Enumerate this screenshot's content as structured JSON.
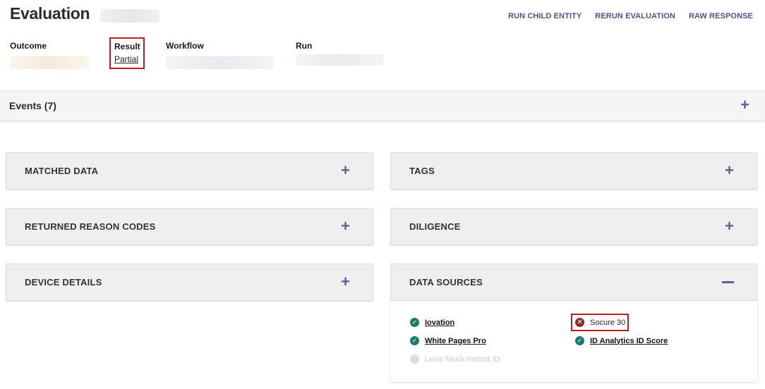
{
  "header": {
    "title": "Evaluation",
    "actions": [
      "RUN CHILD ENTITY",
      "RERUN EVALUATION",
      "RAW RESPONSE"
    ]
  },
  "meta": {
    "outcome_label": "Outcome",
    "result_label": "Result",
    "result_value": "Partial",
    "workflow_label": "Workflow",
    "run_label": "Run"
  },
  "events": {
    "title": "Events (7)",
    "expand_symbol": "+"
  },
  "panels": {
    "matched_data": "MATCHED DATA",
    "tags": "TAGS",
    "returned_reason_codes": "RETURNED REASON CODES",
    "diligence": "DILIGENCE",
    "device_details": "DEVICE DETAILS",
    "data_sources": "DATA SOURCES",
    "expand_symbol": "+"
  },
  "data_sources": [
    {
      "name": "Iovation",
      "status": "success"
    },
    {
      "name": "Socure 30",
      "status": "error"
    },
    {
      "name": "White Pages Pro",
      "status": "success"
    },
    {
      "name": "ID Analytics ID Score",
      "status": "success"
    },
    {
      "name": "Lexis Nexis Instant ID",
      "status": "disabled"
    }
  ],
  "colors": {
    "accent": "#6b5a94",
    "link": "#5e4a86",
    "success": "#1e7a6c",
    "error": "#8e2631",
    "highlight": "#c21d1d"
  },
  "icons": {
    "success": "check-circle-icon",
    "error": "x-circle-icon",
    "disabled": "minus-circle-icon"
  }
}
